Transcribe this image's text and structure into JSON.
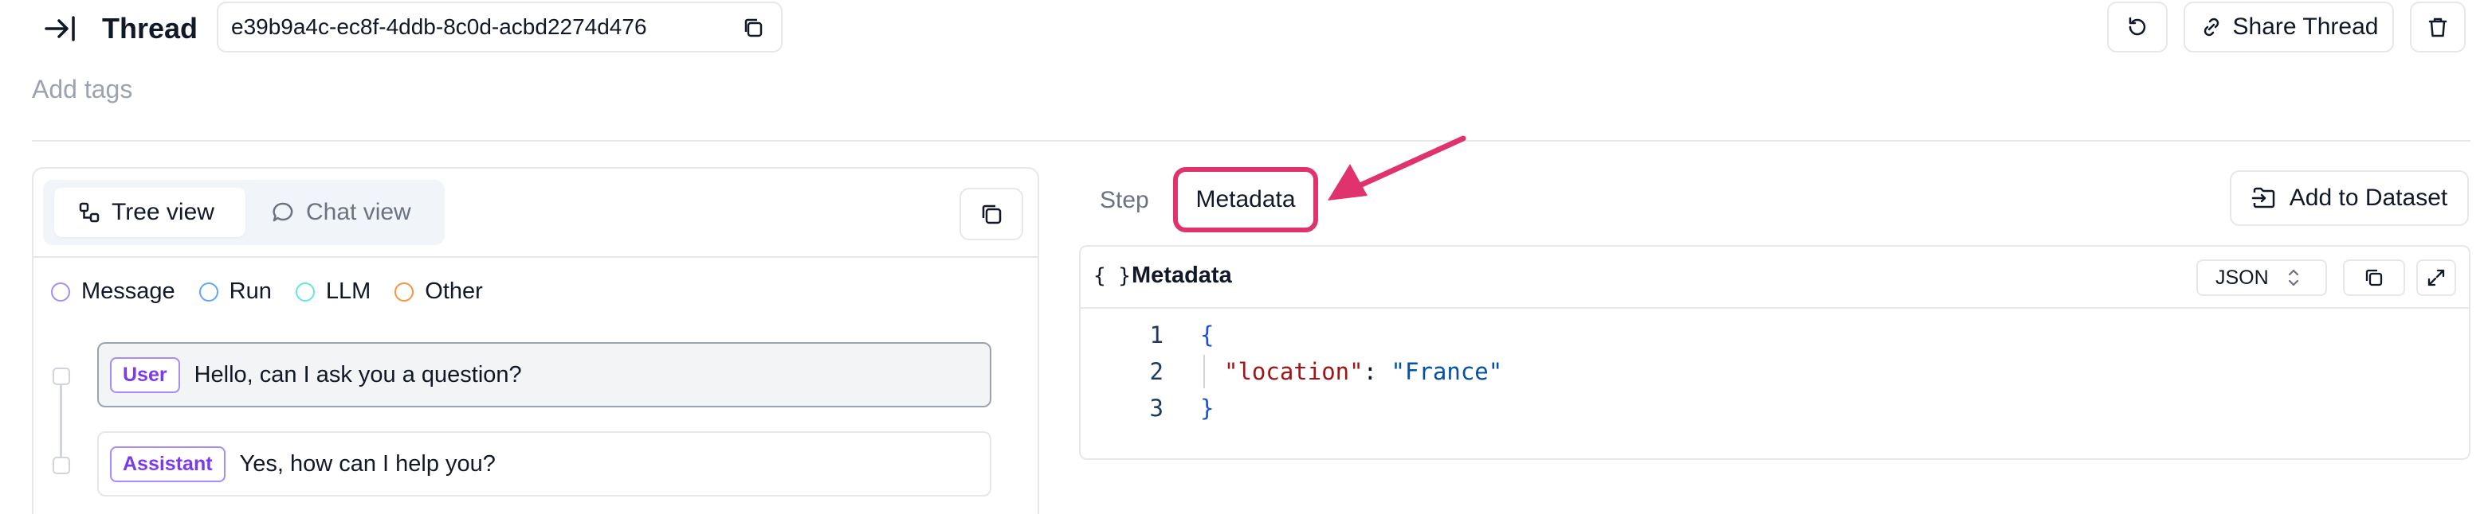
{
  "header": {
    "title": "Thread",
    "thread_id": "e39b9a4c-ec8f-4ddb-8c0d-acbd2274d476",
    "share_label": "Share Thread"
  },
  "tags": {
    "placeholder": "Add tags"
  },
  "left_panel": {
    "tabs": [
      {
        "label": "Tree view",
        "active": true
      },
      {
        "label": "Chat view",
        "active": false
      }
    ],
    "legend": [
      {
        "label": "Message",
        "color": "#a78bfa"
      },
      {
        "label": "Run",
        "color": "#60a5fa"
      },
      {
        "label": "LLM",
        "color": "#5eead4"
      },
      {
        "label": "Other",
        "color": "#fb923c"
      }
    ],
    "messages": [
      {
        "role": "User",
        "text": "Hello, can I ask you a question?"
      },
      {
        "role": "Assistant",
        "text": "Yes, how can I help you?"
      }
    ]
  },
  "right_panel": {
    "tabs": [
      {
        "label": "Step",
        "active": false
      },
      {
        "label": "Metadata",
        "active": true
      }
    ],
    "add_dataset_label": "Add to Dataset",
    "metadata": {
      "title": "Metadata",
      "braces_icon": "{ }",
      "format": "JSON",
      "line_numbers": [
        "1",
        "2",
        "3"
      ],
      "code": {
        "open": "{",
        "key": "\"location\"",
        "colon": ": ",
        "value": "\"France\"",
        "close": "}"
      }
    }
  },
  "colors": {
    "highlight": "#e0336d",
    "badge": "#7c3aed"
  }
}
